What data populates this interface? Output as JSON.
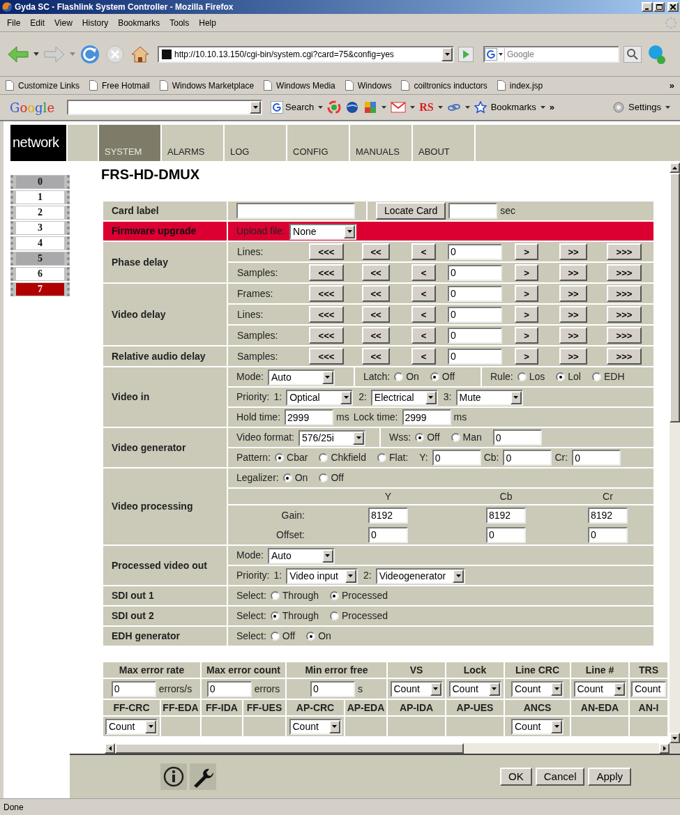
{
  "window": {
    "title": "Gyda SC - Flashlink System Controller - Mozilla Firefox"
  },
  "menu": [
    "File",
    "Edit",
    "View",
    "History",
    "Bookmarks",
    "Tools",
    "Help"
  ],
  "address_bar": {
    "value": "http://10.10.13.150/cgi-bin/system.cgi?card=75&config=yes"
  },
  "search_field": {
    "placeholder": "Google"
  },
  "bookmarks": [
    "Customize Links",
    "Free Hotmail",
    "Windows Marketplace",
    "Windows Media",
    "Windows",
    "coiltronics inductors",
    "index.jsp"
  ],
  "bookmarks_more": "»",
  "google_toolbar": {
    "logo": "Google",
    "search_button": "Search",
    "rs_label": "RS",
    "bookmarks_button": "Bookmarks",
    "more": "»",
    "settings_button": "Settings"
  },
  "site_logo": "network",
  "nav_tabs": [
    {
      "label": "SYSTEM",
      "selected": true
    },
    {
      "label": "ALARMS",
      "selected": false
    },
    {
      "label": "LOG",
      "selected": false
    },
    {
      "label": "CONFIG",
      "selected": false
    },
    {
      "label": "MANUALS",
      "selected": false
    },
    {
      "label": "ABOUT",
      "selected": false
    }
  ],
  "cards": [
    {
      "label": "0",
      "kind": "empty",
      "selected": false
    },
    {
      "label": "1",
      "kind": "card",
      "selected": false
    },
    {
      "label": "2",
      "kind": "card",
      "selected": false
    },
    {
      "label": "3",
      "kind": "card",
      "selected": false
    },
    {
      "label": "4",
      "kind": "card",
      "selected": false
    },
    {
      "label": "5",
      "kind": "empty",
      "selected": false
    },
    {
      "label": "6",
      "kind": "card",
      "selected": false
    },
    {
      "label": "7",
      "kind": "card",
      "selected": true
    }
  ],
  "page_title": "FRS-HD-DMUX",
  "sections": [
    {
      "label": "Card label",
      "alert": false,
      "lines": [
        {
          "kind": "fields",
          "cells": [
            [
              {
                "kind": "input"
              }
            ],
            [
              {
                "kind": "button",
                "label": "Locate Card"
              },
              {
                "kind": "input"
              },
              {
                "kind": "text",
                "text": "sec"
              }
            ]
          ]
        }
      ]
    },
    {
      "label": "Firmware upgrade",
      "alert": true,
      "lines": [
        {
          "kind": "fields",
          "cells": [
            [
              {
                "kind": "text",
                "text": "Upload file:"
              },
              {
                "kind": "select",
                "value": "None"
              }
            ]
          ]
        }
      ]
    },
    {
      "label": "Phase delay",
      "alert": false,
      "lines": [
        {
          "kind": "stepper",
          "label": "Lines:",
          "left": [
            "<<<",
            "<<",
            "<"
          ],
          "value": "0",
          "right": [
            ">",
            ">>",
            ">>>"
          ]
        },
        {
          "kind": "stepper",
          "label": "Samples:",
          "left": [
            "<<<",
            "<<",
            "<"
          ],
          "value": "0",
          "right": [
            ">",
            ">>",
            ">>>"
          ]
        }
      ]
    },
    {
      "label": "Video delay",
      "alert": false,
      "lines": [
        {
          "kind": "stepper",
          "label": "Frames:",
          "left": [
            "<<<",
            "<<",
            "<"
          ],
          "value": "0",
          "right": [
            ">",
            ">>",
            ">>>"
          ]
        },
        {
          "kind": "stepper",
          "label": "Lines:",
          "left": [
            "<<<",
            "<<",
            "<"
          ],
          "value": "0",
          "right": [
            ">",
            ">>",
            ">>>"
          ]
        },
        {
          "kind": "stepper",
          "label": "Samples:",
          "left": [
            "<<<",
            "<<",
            "<"
          ],
          "value": "0",
          "right": [
            ">",
            ">>",
            ">>>"
          ]
        }
      ]
    },
    {
      "label": "Relative audio delay",
      "alert": false,
      "lines": [
        {
          "kind": "stepper",
          "label": "Samples:",
          "left": [
            "<<<",
            "<<",
            "<"
          ],
          "value": "0",
          "right": [
            ">",
            ">>",
            ">>>"
          ]
        }
      ]
    },
    {
      "label": "Video in",
      "alert": false,
      "lines": [
        {
          "kind": "fields",
          "cells": [
            [
              {
                "kind": "text",
                "text": "Mode:"
              },
              {
                "kind": "select",
                "value": "Auto"
              }
            ],
            [
              {
                "kind": "text",
                "text": "Latch:"
              },
              {
                "kind": "radio",
                "label": "On",
                "selected": false
              },
              {
                "kind": "radio",
                "label": "Off",
                "selected": true
              }
            ],
            [
              {
                "kind": "text",
                "text": "Rule:"
              },
              {
                "kind": "radio",
                "label": "Los",
                "selected": false
              },
              {
                "kind": "radio",
                "label": "Lol",
                "selected": true
              },
              {
                "kind": "radio",
                "label": "EDH",
                "selected": false
              }
            ]
          ]
        },
        {
          "kind": "fields",
          "cells": [
            [
              {
                "kind": "text",
                "text": "Priority:"
              },
              {
                "kind": "text",
                "text": "1:"
              },
              {
                "kind": "select",
                "value": "Optical"
              },
              {
                "kind": "text",
                "text": "2:"
              },
              {
                "kind": "select",
                "value": "Electrical"
              },
              {
                "kind": "text",
                "text": "3:"
              },
              {
                "kind": "select",
                "value": "Mute"
              }
            ]
          ]
        },
        {
          "kind": "fields",
          "cells": [
            [
              {
                "kind": "text",
                "text": "Hold time:"
              },
              {
                "kind": "input",
                "value": "2999"
              },
              {
                "kind": "text",
                "text": "ms"
              },
              {
                "kind": "text",
                "text": "Lock time:"
              },
              {
                "kind": "input",
                "value": "2999"
              },
              {
                "kind": "text",
                "text": "ms"
              }
            ]
          ]
        }
      ]
    },
    {
      "label": "Video generator",
      "alert": false,
      "lines": [
        {
          "kind": "fields",
          "cells": [
            [
              {
                "kind": "text",
                "text": "Video format:"
              },
              {
                "kind": "select",
                "value": "576/25i"
              }
            ],
            [
              {
                "kind": "text",
                "text": "Wss:"
              },
              {
                "kind": "radio",
                "label": "Off",
                "selected": true
              },
              {
                "kind": "radio",
                "label": "Man",
                "selected": false
              },
              {
                "kind": "input",
                "value": "0"
              }
            ]
          ]
        },
        {
          "kind": "fields",
          "cells": [
            [
              {
                "kind": "text",
                "text": "Pattern:"
              },
              {
                "kind": "radio",
                "label": "Cbar",
                "selected": true
              },
              {
                "kind": "radio",
                "label": "Chkfield",
                "selected": false
              },
              {
                "kind": "radio",
                "label": "Flat:",
                "selected": false
              },
              {
                "kind": "text",
                "text": "Y:"
              },
              {
                "kind": "input",
                "value": "0"
              },
              {
                "kind": "text",
                "text": "Cb:"
              },
              {
                "kind": "input",
                "value": "0"
              },
              {
                "kind": "text",
                "text": "Cr:"
              },
              {
                "kind": "input",
                "value": "0"
              }
            ]
          ]
        }
      ]
    },
    {
      "label": "Video processing",
      "alert": false,
      "lines": [
        {
          "kind": "fields",
          "cells": [
            [
              {
                "kind": "text",
                "text": "Legalizer:"
              },
              {
                "kind": "radio",
                "label": "On",
                "selected": true
              },
              {
                "kind": "radio",
                "label": "Off",
                "selected": false
              }
            ]
          ]
        },
        {
          "kind": "matrix",
          "columns": [
            "Y",
            "Cb",
            "Cr"
          ],
          "rows": [
            {
              "label": "Gain:",
              "values": [
                "8192",
                "8192",
                "8192"
              ]
            },
            {
              "label": "Offset:",
              "values": [
                "0",
                "0",
                "0"
              ]
            }
          ]
        }
      ]
    },
    {
      "label": "Processed video out",
      "alert": false,
      "lines": [
        {
          "kind": "fields",
          "cells": [
            [
              {
                "kind": "text",
                "text": "Mode:"
              },
              {
                "kind": "select",
                "value": "Auto"
              }
            ]
          ]
        },
        {
          "kind": "fields",
          "cells": [
            [
              {
                "kind": "text",
                "text": "Priority:"
              },
              {
                "kind": "text",
                "text": "1:"
              },
              {
                "kind": "select",
                "value": "Video input"
              },
              {
                "kind": "text",
                "text": "2:"
              },
              {
                "kind": "select",
                "value": "Videogenerator"
              }
            ]
          ]
        }
      ]
    },
    {
      "label": "SDI out 1",
      "alert": false,
      "lines": [
        {
          "kind": "fields",
          "cells": [
            [
              {
                "kind": "text",
                "text": "Select:"
              },
              {
                "kind": "radio",
                "label": "Through",
                "selected": false
              },
              {
                "kind": "radio",
                "label": "Processed",
                "selected": true
              }
            ]
          ]
        }
      ]
    },
    {
      "label": "SDI out 2",
      "alert": false,
      "lines": [
        {
          "kind": "fields",
          "cells": [
            [
              {
                "kind": "text",
                "text": "Select:"
              },
              {
                "kind": "radio",
                "label": "Through",
                "selected": true
              },
              {
                "kind": "radio",
                "label": "Processed",
                "selected": false
              }
            ]
          ]
        }
      ]
    },
    {
      "label": "EDH generator",
      "alert": false,
      "lines": [
        {
          "kind": "fields",
          "cells": [
            [
              {
                "kind": "text",
                "text": "Select:"
              },
              {
                "kind": "radio",
                "label": "Off",
                "selected": false
              },
              {
                "kind": "radio",
                "label": "On",
                "selected": true
              }
            ]
          ]
        }
      ]
    }
  ],
  "error_tables": [
    {
      "columns": [
        "Max error rate",
        "Max error count",
        "Min error free",
        "VS",
        "Lock",
        "Line CRC",
        "Line #",
        "TRS"
      ],
      "cells": [
        {
          "kind": "input",
          "value": "0",
          "unit": "errors/s"
        },
        {
          "kind": "input",
          "value": "0",
          "unit": "errors"
        },
        {
          "kind": "input",
          "value": "0",
          "unit": "s"
        },
        {
          "kind": "select",
          "value": "Count"
        },
        {
          "kind": "select",
          "value": "Count"
        },
        {
          "kind": "select",
          "value": "Count"
        },
        {
          "kind": "select",
          "value": "Count"
        },
        {
          "kind": "select",
          "value": "Count"
        }
      ]
    },
    {
      "columns": [
        "FF-CRC",
        "FF-EDA",
        "FF-IDA",
        "FF-UES",
        "AP-CRC",
        "AP-EDA",
        "AP-IDA",
        "AP-UES",
        "ANCS",
        "AN-EDA",
        "AN-I"
      ],
      "cells": [
        {
          "kind": "select",
          "value": "Count"
        },
        {
          "kind": "empty"
        },
        {
          "kind": "empty"
        },
        {
          "kind": "empty"
        },
        {
          "kind": "select",
          "value": "Count"
        },
        {
          "kind": "empty"
        },
        {
          "kind": "empty"
        },
        {
          "kind": "empty"
        },
        {
          "kind": "select",
          "value": "Count"
        },
        {
          "kind": "empty"
        },
        {
          "kind": "empty"
        }
      ]
    }
  ],
  "footer_buttons": [
    "OK",
    "Cancel",
    "Apply"
  ],
  "status_bar": "Done"
}
